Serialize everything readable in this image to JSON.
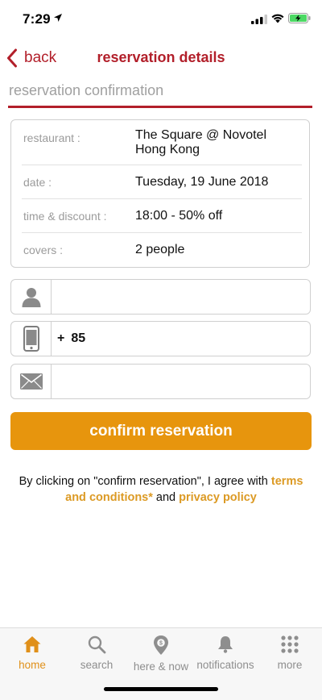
{
  "status_bar": {
    "time": "7:29",
    "icons": [
      "location-arrow-icon",
      "signal-icon",
      "wifi-icon",
      "battery-charging-icon"
    ]
  },
  "nav": {
    "back_label": "back",
    "title": "reservation details"
  },
  "section": {
    "heading": "reservation confirmation"
  },
  "details": [
    {
      "label": "restaurant :",
      "value": "The Square @ Novotel Hong Kong"
    },
    {
      "label": "date :",
      "value": "Tuesday, 19 June 2018"
    },
    {
      "label": "time & discount :",
      "value": "18:00 - 50% off"
    },
    {
      "label": "covers :",
      "value": "2 people"
    }
  ],
  "form": {
    "name": {
      "icon": "person-icon",
      "value": ""
    },
    "phone": {
      "icon": "mobile-phone-icon",
      "prefix": "+",
      "value": "85"
    },
    "email": {
      "icon": "envelope-icon",
      "value": ""
    }
  },
  "confirm_button": {
    "label": "confirm reservation"
  },
  "terms": {
    "before": "By clicking on \"confirm reservation\", I agree with ",
    "terms_link": "terms and conditions*",
    "middle": " and ",
    "privacy_link": "privacy policy"
  },
  "tabs": [
    {
      "label": "home",
      "icon": "home-icon",
      "active": true
    },
    {
      "label": "search",
      "icon": "search-icon",
      "active": false
    },
    {
      "label": "here & now",
      "icon": "map-pin-icon",
      "active": false
    },
    {
      "label": "notifications",
      "icon": "bell-icon",
      "active": false
    },
    {
      "label": "more",
      "icon": "grid-dots-icon",
      "active": false
    }
  ],
  "colors": {
    "brand_red": "#b21f2a",
    "accent_orange": "#e7950d",
    "link_orange": "#dc9a24",
    "tab_active": "#e0901a",
    "tab_inactive": "#8e8e8e"
  }
}
